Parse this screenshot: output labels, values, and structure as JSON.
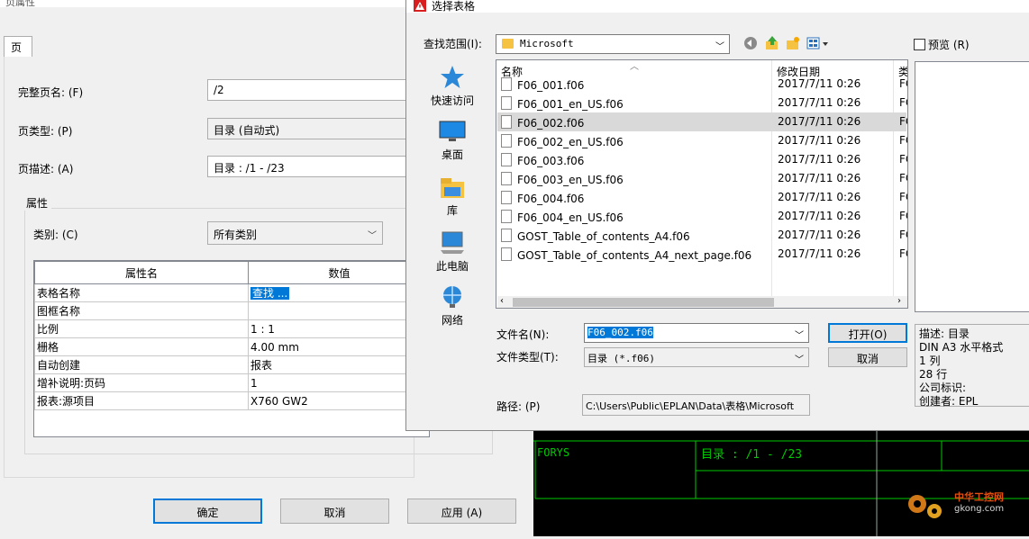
{
  "props_dialog": {
    "title": "页属性",
    "tab": "页",
    "full_page_name_label": "完整页名: (F)",
    "full_page_name": "/2",
    "page_type_label": "页类型: (P)",
    "page_type": "目录 (自动式)",
    "page_desc_label": "页描述: (A)",
    "page_desc": "目录 : /1 - /23",
    "group_title": "属性",
    "category_label": "类别: (C)",
    "category": "所有类别",
    "grid_headers": [
      "属性名",
      "数值"
    ],
    "grid_rows": [
      {
        "name": "表格名称",
        "value": "查找 ..."
      },
      {
        "name": "图框名称",
        "value": ""
      },
      {
        "name": "比例",
        "value": "1 : 1"
      },
      {
        "name": "栅格",
        "value": "4.00 mm"
      },
      {
        "name": "自动创建",
        "value": "报表"
      },
      {
        "name": "增补说明:页码",
        "value": "1"
      },
      {
        "name": "报表:源项目",
        "value": "X760 GW2"
      }
    ],
    "ok": "确定",
    "cancel": "取消",
    "apply": "应用 (A)"
  },
  "select_dialog": {
    "title": "选择表格",
    "look_in_label": "查找范围(I):",
    "look_in": "Microsoft",
    "places": [
      "快速访问",
      "桌面",
      "库",
      "此电脑",
      "网络"
    ],
    "col_name": "名称",
    "col_date": "修改日期",
    "col_type": "类",
    "files": [
      {
        "name": "F06_001.f06",
        "date": "2017/7/11 0:26",
        "type": "FC"
      },
      {
        "name": "F06_001_en_US.f06",
        "date": "2017/7/11 0:26",
        "type": "FC"
      },
      {
        "name": "F06_002.f06",
        "date": "2017/7/11 0:26",
        "type": "FC"
      },
      {
        "name": "F06_002_en_US.f06",
        "date": "2017/7/11 0:26",
        "type": "FC"
      },
      {
        "name": "F06_003.f06",
        "date": "2017/7/11 0:26",
        "type": "FC"
      },
      {
        "name": "F06_003_en_US.f06",
        "date": "2017/7/11 0:26",
        "type": "FC"
      },
      {
        "name": "F06_004.f06",
        "date": "2017/7/11 0:26",
        "type": "FC"
      },
      {
        "name": "F06_004_en_US.f06",
        "date": "2017/7/11 0:26",
        "type": "FC"
      },
      {
        "name": "GOST_Table_of_contents_A4.f06",
        "date": "2017/7/11 0:26",
        "type": "FC"
      },
      {
        "name": "GOST_Table_of_contents_A4_next_page.f06",
        "date": "2017/7/11 0:26",
        "type": "FC"
      }
    ],
    "preview_label": "预览 (R)",
    "file_name_label": "文件名(N):",
    "file_name": "F06_002.f06",
    "file_type_label": "文件类型(T):",
    "file_type": "目录 (*.f06)",
    "path_label": "路径: (P)",
    "path": "C:\\Users\\Public\\EPLAN\\Data\\表格\\Microsoft",
    "open": "打开(O)",
    "cancel": "取消",
    "info_lines": [
      "描述: 目录",
      "DIN A3 水平格式",
      "1 列",
      "28 行",
      "公司标识:",
      "创建者: EPL"
    ]
  },
  "cad": {
    "left_text": "FORYS",
    "title_text": "目录 : /1 - /23",
    "watermark": "中华工控网",
    "watermark_url": "gkong.com"
  }
}
